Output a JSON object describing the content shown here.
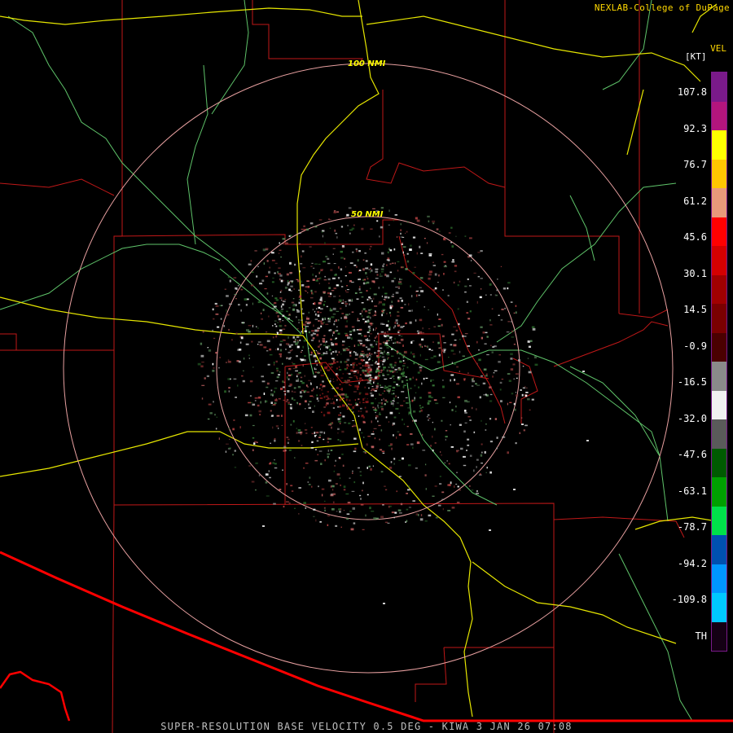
{
  "header": {
    "credit": "NEXLAB-College of DuPage",
    "product": "VEL",
    "units": "[KT]"
  },
  "range_rings": {
    "outer_label": "100 NMI",
    "inner_label": "50 NMI"
  },
  "legend": {
    "ticks": [
      "107.8",
      "92.3",
      "76.7",
      "61.2",
      "45.6",
      "30.1",
      "14.5",
      "-0.9",
      "-16.5",
      "-32.0",
      "-47.6",
      "-63.1",
      "-78.7",
      "-94.2",
      "-109.8",
      "TH"
    ],
    "colors": [
      "#7a1a8a",
      "#b3157d",
      "#ffff00",
      "#ffc600",
      "#e8997a",
      "#ff0000",
      "#d40000",
      "#a00000",
      "#7a0000",
      "#4a0000",
      "#8a8a8a",
      "#f0f0f0",
      "#5a5a5a",
      "#005a00",
      "#00a000",
      "#00e04a",
      "#0050b0",
      "#0096ff",
      "#00c8ff",
      "#140014"
    ]
  },
  "footer": {
    "title": "SUPER-RESOLUTION BASE VELOCITY 0.5 DEG - KIWA 3 JAN 26 07:08"
  },
  "colors": {
    "county_lines": "#c01818",
    "highways": "#e6e600",
    "roads": "#5fc46a",
    "range_rings": "#e8a0a0",
    "border": "#ff0000"
  }
}
